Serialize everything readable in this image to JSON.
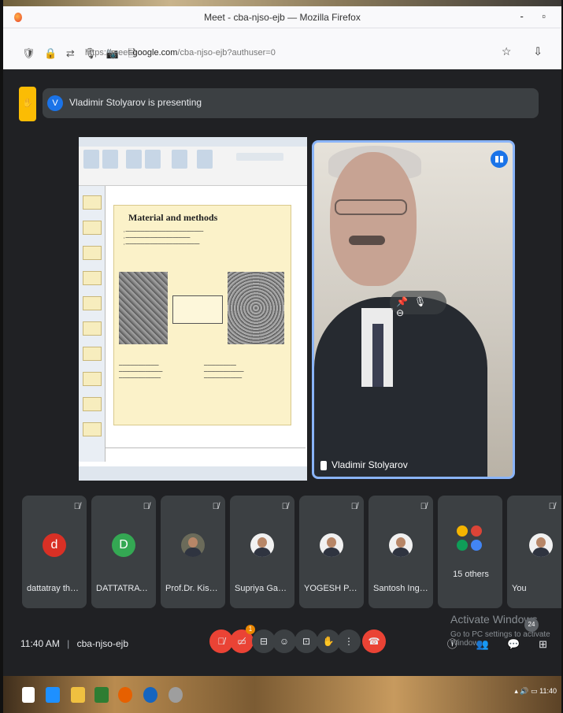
{
  "browser": {
    "window_title": "Meet - cba-njso-ejb — Mozilla Firefox",
    "url_prefix": "https://meet.",
    "url_domain": "google.com",
    "url_suffix": "/cba-njso-ejb?authuser=0",
    "window_buttons": "- ▫"
  },
  "meet": {
    "presenter_initial": "V",
    "presenting_text": "Vladimir Stolyarov is presenting",
    "slide": {
      "title": "Material and methods"
    },
    "speaker_name": "Vladimir Stolyarov",
    "participants": [
      {
        "name": "dattatray thange",
        "initial": "d",
        "color": "#d93025",
        "type": "letter"
      },
      {
        "name": "DATTATRAYA TH...",
        "initial": "D",
        "color": "#34a853",
        "type": "letter"
      },
      {
        "name": "Prof.Dr. Kishor K...",
        "type": "photo"
      },
      {
        "name": "Supriya Gadhe",
        "type": "photo"
      },
      {
        "name": "YOGESH PATHARE",
        "type": "photo"
      },
      {
        "name": "Santosh Ingole",
        "type": "photo"
      },
      {
        "name": "15 others",
        "type": "others"
      },
      {
        "name": "You",
        "type": "photo"
      }
    ],
    "time": "11:40 AM",
    "meeting_code": "cba-njso-ejb",
    "raise_hand_count": "1",
    "people_count": "24",
    "activate_line1": "Activate Windows",
    "activate_line2": "Go to PC settings to activate Windows."
  },
  "taskbar": {
    "clock": "11:40"
  }
}
